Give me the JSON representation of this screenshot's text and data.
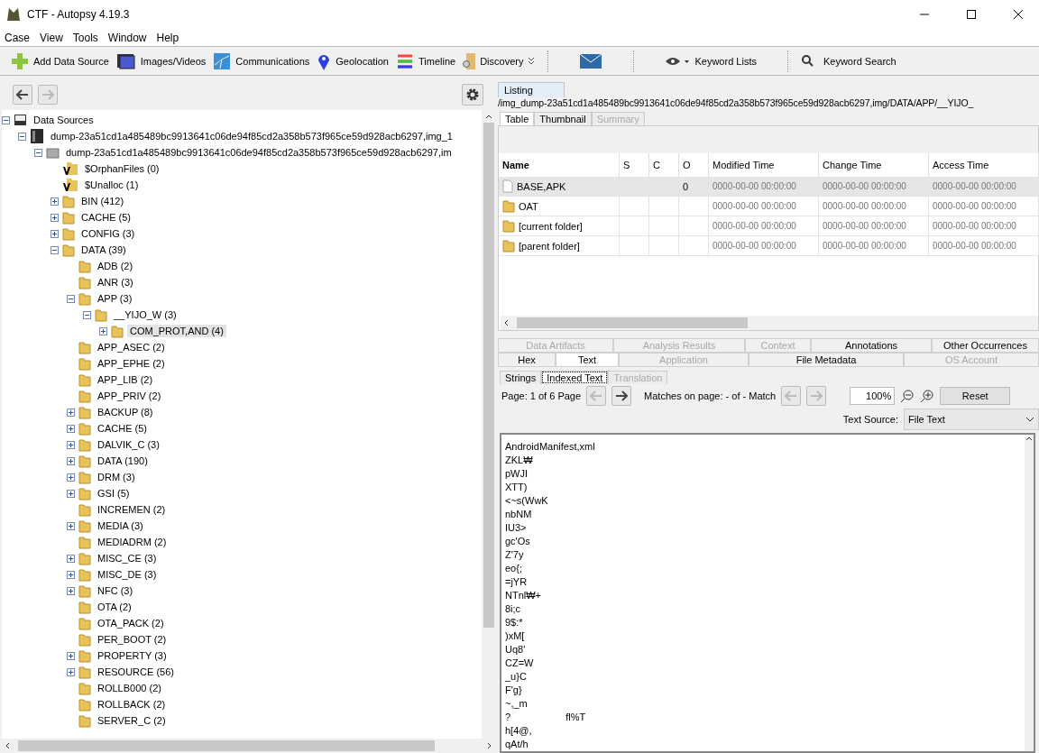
{
  "window": {
    "title": "CTF - Autopsy 4.19.3"
  },
  "menu": [
    "Case",
    "View",
    "Tools",
    "Window",
    "Help"
  ],
  "toolbar": [
    {
      "kind": "add",
      "label": "Add Data Source"
    },
    {
      "kind": "images",
      "label": "Images/Videos"
    },
    {
      "kind": "comms",
      "label": "Communications"
    },
    {
      "kind": "geo",
      "label": "Geolocation"
    },
    {
      "kind": "timeline",
      "label": "Timeline"
    },
    {
      "kind": "discovery",
      "label": "Discovery"
    },
    {
      "kind": "mail"
    },
    {
      "kind": "lists",
      "label": "Keyword Lists"
    },
    {
      "kind": "search",
      "label": "Keyword Search"
    }
  ],
  "tree": [
    {
      "kind": "sources",
      "label": "Data Sources",
      "expanded": true,
      "selected": false,
      "children": [
        {
          "kind": "image",
          "label": "dump-23a51cd1a485489bc9913641c06de94f85cd2a358b573f965ce59d928acb6297,img_1",
          "expanded": true,
          "selected": false,
          "children": [
            {
              "kind": "volume",
              "label": "dump-23a51cd1a485489bc9913641c06de94f85cd2a358b573f965ce59d928acb6297,im",
              "expanded": true,
              "selected": false,
              "children": [
                {
                  "kind": "virtual",
                  "label": "$OrphanFiles (0)",
                  "selected": false
                },
                {
                  "kind": "virtual",
                  "label": "$Unalloc (1)",
                  "selected": false
                },
                {
                  "kind": "folder",
                  "label": "BIN (412)",
                  "expanded": false,
                  "selected": false
                },
                {
                  "kind": "folder",
                  "label": "CACHE (5)",
                  "expanded": false,
                  "selected": false
                },
                {
                  "kind": "folder",
                  "label": "CONFIG (3)",
                  "expanded": false,
                  "selected": false
                },
                {
                  "kind": "folder",
                  "label": "DATA (39)",
                  "expanded": true,
                  "selected": false,
                  "children": [
                    {
                      "kind": "folder",
                      "label": "ADB (2)",
                      "selected": false
                    },
                    {
                      "kind": "folder",
                      "label": "ANR (3)",
                      "selected": false
                    },
                    {
                      "kind": "folder",
                      "label": "APP (3)",
                      "expanded": true,
                      "selected": false,
                      "children": [
                        {
                          "kind": "folder",
                          "label": "__YIJO_W (3)",
                          "expanded": true,
                          "selected": false,
                          "children": [
                            {
                              "kind": "folder",
                              "label": "COM_PROT,AND (4)",
                              "expanded": false,
                              "selected": true
                            }
                          ]
                        }
                      ]
                    },
                    {
                      "kind": "folder",
                      "label": "APP_ASEC (2)",
                      "selected": false
                    },
                    {
                      "kind": "folder",
                      "label": "APP_EPHE (2)",
                      "selected": false
                    },
                    {
                      "kind": "folder",
                      "label": "APP_LIB (2)",
                      "selected": false
                    },
                    {
                      "kind": "folder",
                      "label": "APP_PRIV (2)",
                      "selected": false
                    },
                    {
                      "kind": "folder",
                      "label": "BACKUP (8)",
                      "expanded": false,
                      "selected": false
                    },
                    {
                      "kind": "folder",
                      "label": "CACHE (5)",
                      "expanded": false,
                      "selected": false
                    },
                    {
                      "kind": "folder",
                      "label": "DALVIK_C (3)",
                      "expanded": false,
                      "selected": false
                    },
                    {
                      "kind": "folder",
                      "label": "DATA (190)",
                      "expanded": false,
                      "selected": false
                    },
                    {
                      "kind": "folder",
                      "label": "DRM (3)",
                      "expanded": false,
                      "selected": false
                    },
                    {
                      "kind": "folder",
                      "label": "GSI (5)",
                      "expanded": false,
                      "selected": false
                    },
                    {
                      "kind": "folder",
                      "label": "INCREMEN (2)",
                      "selected": false
                    },
                    {
                      "kind": "folder",
                      "label": "MEDIA (3)",
                      "expanded": false,
                      "selected": false
                    },
                    {
                      "kind": "folder",
                      "label": "MEDIADRM (2)",
                      "selected": false
                    },
                    {
                      "kind": "folder",
                      "label": "MISC_CE (3)",
                      "expanded": false,
                      "selected": false
                    },
                    {
                      "kind": "folder",
                      "label": "MISC_DE (3)",
                      "expanded": false,
                      "selected": false
                    },
                    {
                      "kind": "folder",
                      "label": "NFC (3)",
                      "expanded": false,
                      "selected": false
                    },
                    {
                      "kind": "folder",
                      "label": "OTA (2)",
                      "selected": false
                    },
                    {
                      "kind": "folder",
                      "label": "OTA_PACK (2)",
                      "selected": false
                    },
                    {
                      "kind": "folder",
                      "label": "PER_BOOT (2)",
                      "selected": false
                    },
                    {
                      "kind": "folder",
                      "label": "PROPERTY (3)",
                      "expanded": false,
                      "selected": false
                    },
                    {
                      "kind": "folder",
                      "label": "RESOURCE (56)",
                      "expanded": false,
                      "selected": false
                    },
                    {
                      "kind": "folder",
                      "label": "ROLLB000 (2)",
                      "selected": false
                    },
                    {
                      "kind": "folder",
                      "label": "ROLLBACK (2)",
                      "selected": false
                    },
                    {
                      "kind": "folder",
                      "label": "SERVER_C (2)",
                      "selected": false
                    }
                  ]
                }
              ]
            }
          ]
        }
      ]
    }
  ],
  "listing": {
    "tab": "Listing",
    "path": "/img_dump-23a51cd1a485489bc9913641c06de94f85cd2a358b573f965ce59d928acb6297,img/DATA/APP/__YIJO_",
    "view_tabs": [
      {
        "label": "Table",
        "selected": true,
        "disabled": false
      },
      {
        "label": "Thumbnail",
        "selected": false,
        "disabled": false
      },
      {
        "label": "Summary",
        "selected": false,
        "disabled": true
      }
    ],
    "table": {
      "columns": [
        "Name",
        "S",
        "C",
        "O",
        "Modified Time",
        "Change Time",
        "Access Time"
      ],
      "rows": [
        {
          "kind": "file",
          "selected": true,
          "cells": [
            "BASE,APK",
            "",
            "",
            "0",
            "0000-00-00 00:00:00",
            "0000-00-00 00:00:00",
            "0000-00-00 00:00:00"
          ]
        },
        {
          "kind": "folder",
          "selected": false,
          "cells": [
            "OAT",
            "",
            "",
            "",
            "0000-00-00 00:00:00",
            "0000-00-00 00:00:00",
            "0000-00-00 00:00:00"
          ]
        },
        {
          "kind": "folder",
          "selected": false,
          "cells": [
            "[current folder]",
            "",
            "",
            "",
            "0000-00-00 00:00:00",
            "0000-00-00 00:00:00",
            "0000-00-00 00:00:00"
          ]
        },
        {
          "kind": "folder",
          "selected": false,
          "cells": [
            "[parent folder]",
            "",
            "",
            "",
            "0000-00-00 00:00:00",
            "0000-00-00 00:00:00",
            "0000-00-00 00:00:00"
          ]
        }
      ]
    }
  },
  "content": {
    "tab_rows": [
      [
        {
          "label": "Data Artifacts",
          "selected": false,
          "disabled": true
        },
        {
          "label": "Analysis Results",
          "selected": false,
          "disabled": true
        },
        {
          "label": "Context",
          "selected": false,
          "disabled": true
        },
        {
          "label": "Annotations",
          "selected": false,
          "disabled": false
        },
        {
          "label": "Other Occurrences",
          "selected": false,
          "disabled": false
        }
      ],
      [
        {
          "label": "Hex",
          "selected": false,
          "disabled": false
        },
        {
          "label": "Text",
          "selected": true,
          "disabled": false
        },
        {
          "label": "Application",
          "selected": false,
          "disabled": true
        },
        {
          "label": "File Metadata",
          "selected": false,
          "disabled": false
        },
        {
          "label": "OS Account",
          "selected": false,
          "disabled": true
        }
      ]
    ],
    "sub_tabs": [
      {
        "label": "Strings",
        "selected": false,
        "disabled": false
      },
      {
        "label": "Indexed Text",
        "selected": true,
        "disabled": false
      },
      {
        "label": "Translation",
        "selected": false,
        "disabled": true
      }
    ],
    "page": "Page: 1 of 6 Page",
    "matches": "Matches on page: - of - Match",
    "zoom": "100%",
    "reset": "Reset",
    "source_label": "Text Source:",
    "source_value": "File Text",
    "lines": [
      "AndroidManifest,xml",
      "ZKL₩",
      "pWJI",
      "XTT)",
      "<~s(WwK",
      "nbNM",
      "IU3>",
      "gc'Os",
      "Z'7y",
      "eo{;",
      "=jYR",
      "NTnl₩+",
      "8i;c",
      "9$:*",
      ")xM[",
      "Uq8'",
      "CZ=W",
      "_u}C",
      "F'g}",
      "~,_m",
      "?                    fl%T",
      "h[4@,",
      "qAt/h"
    ]
  }
}
